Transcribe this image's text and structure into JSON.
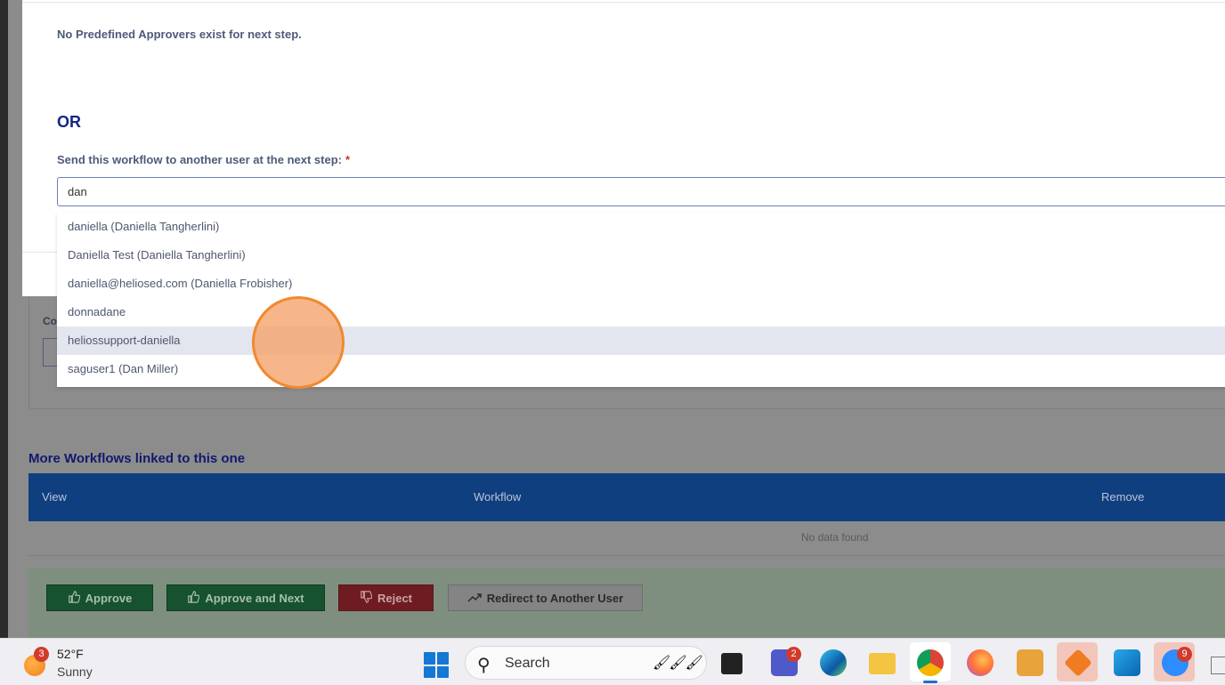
{
  "modal": {
    "no_approvers_text": "No Predefined Approvers exist for next step.",
    "or_text": "OR",
    "send_label": "Send this workflow to another user at the next step:",
    "required_mark": "*",
    "user_input_value": "dan"
  },
  "autocomplete": {
    "items": [
      {
        "label": "daniella (Daniella Tangherlini)",
        "highlighted": false
      },
      {
        "label": "Daniella Test (Daniella Tangherlini)",
        "highlighted": false
      },
      {
        "label": "daniella@heliosed.com (Daniella Frobisher)",
        "highlighted": false
      },
      {
        "label": "donnadane",
        "highlighted": false
      },
      {
        "label": "heliossupport-daniella",
        "highlighted": true
      },
      {
        "label": "saguser1 (Dan Miller)",
        "highlighted": false
      }
    ]
  },
  "background_page": {
    "comment_label_partial": "Co",
    "linked_title": "More Workflows linked to this one",
    "table": {
      "columns": [
        "View",
        "Workflow",
        "Remove"
      ],
      "empty_text": "No data found"
    },
    "actions": {
      "approve": "Approve",
      "approve_next": "Approve and Next",
      "reject": "Reject",
      "redirect": "Redirect to Another User"
    }
  },
  "taskbar": {
    "weather": {
      "badge": "3",
      "temperature": "52°F",
      "condition": "Sunny"
    },
    "search_placeholder": "Search",
    "teams_badge": "2",
    "zoom_badge": "9",
    "icons": [
      "start-icon",
      "search-icon",
      "task-view-icon",
      "teams-icon",
      "edge-icon",
      "file-explorer-icon",
      "chrome-icon",
      "firefox-icon",
      "snipping-tool-icon",
      "app-icon",
      "outlook-icon",
      "zoom-icon"
    ]
  },
  "colors": {
    "accent_blue": "#152585",
    "table_header_bg": "#103f7f",
    "approve_green": "#16522e",
    "reject_red": "#6e1c22",
    "click_indicator": "#f08a2e"
  }
}
